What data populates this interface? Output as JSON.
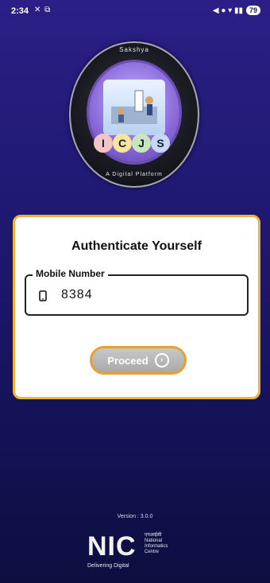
{
  "status_bar": {
    "time": "2:34",
    "left_icons": "✕ ⧉",
    "right_icons": "◀ ● ▾ ▮▮",
    "battery": "79"
  },
  "logo": {
    "top_text": "Sakshya",
    "letters": [
      "I",
      "C",
      "J",
      "S"
    ],
    "bottom_text": "A Digital Platform"
  },
  "card": {
    "title": "Authenticate Yourself",
    "field_label": "Mobile Number",
    "field_value": "8384",
    "proceed_label": "Proceed"
  },
  "footer": {
    "version": "Version : 3.0.0",
    "org_acronym": "NIC",
    "org_hindi": "एनआईसी",
    "org_name_lines": [
      "National",
      "Informatics",
      "Centre"
    ],
    "org_bottom": "Delivering Digital"
  },
  "colors": {
    "background": "#1e1870",
    "card_border": "#f0b23a",
    "button_border": "#e8a032"
  }
}
